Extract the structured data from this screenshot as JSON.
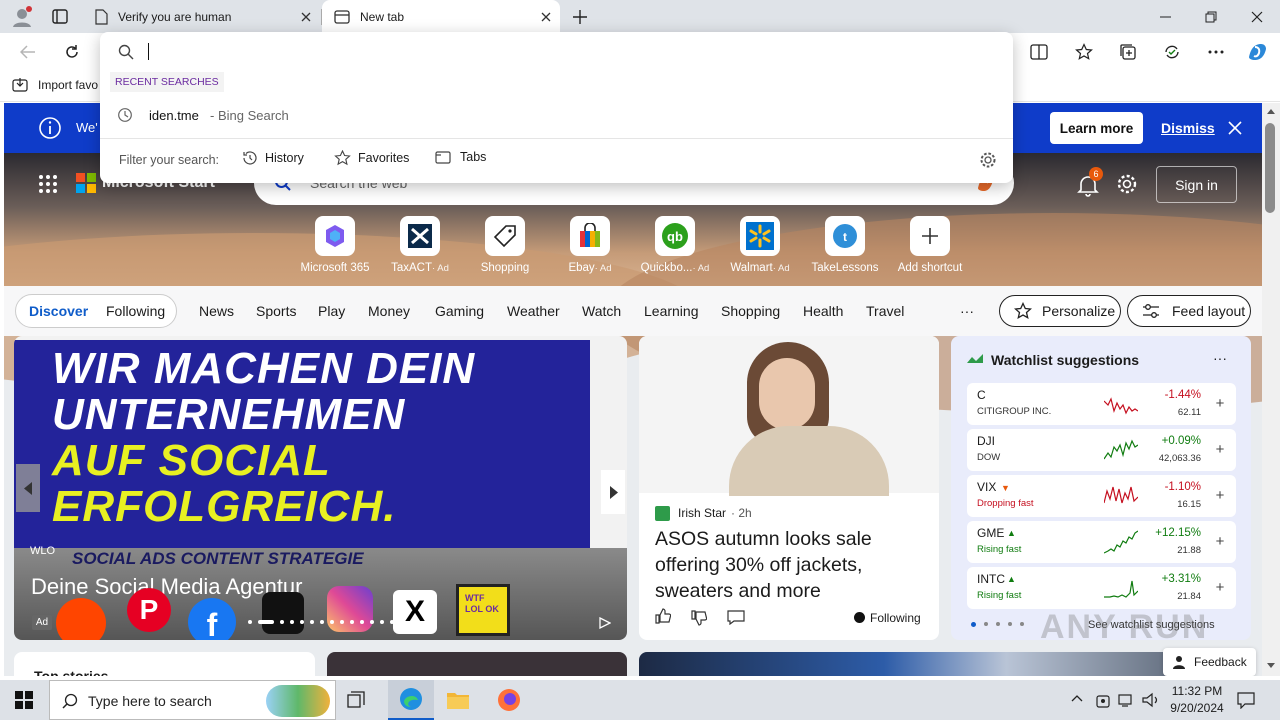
{
  "browser": {
    "tabs": [
      {
        "title": "Verify you are human"
      },
      {
        "title": "New tab"
      }
    ],
    "favorites_bar": {
      "import_label": "Import favo"
    },
    "address_dropdown": {
      "input_value": "",
      "section_label": "RECENT SEARCHES",
      "recent": [
        {
          "query": "iden.tme",
          "source": "- Bing Search"
        }
      ],
      "filter_label": "Filter your search:",
      "filters": [
        "History",
        "Favorites",
        "Tabs"
      ]
    }
  },
  "infobar": {
    "text_fragment": "We'",
    "learn_more": "Learn more",
    "dismiss": "Dismiss"
  },
  "header": {
    "brand": "Microsoft Start",
    "search_placeholder": "Search the web",
    "notification_count": "6",
    "sign_in": "Sign in"
  },
  "shortcuts": [
    {
      "label": "Microsoft 365",
      "ad": ""
    },
    {
      "label": "TaxACT",
      "ad": "· Ad"
    },
    {
      "label": "Shopping",
      "ad": ""
    },
    {
      "label": "Ebay",
      "ad": "· Ad"
    },
    {
      "label": "Quickbo...",
      "ad": "· Ad"
    },
    {
      "label": "Walmart",
      "ad": "· Ad"
    },
    {
      "label": "TakeLessons",
      "ad": ""
    },
    {
      "label": "Add shortcut",
      "ad": ""
    }
  ],
  "feed_nav": {
    "tabs": [
      "Discover",
      "Following"
    ],
    "categories": [
      "News",
      "Sports",
      "Play",
      "Money",
      "Gaming",
      "Weather",
      "Watch",
      "Learning",
      "Shopping",
      "Health",
      "Travel"
    ],
    "more": "···",
    "personalize": "Personalize",
    "feed_layout": "Feed layout"
  },
  "ad_card": {
    "line1": "WIR MACHEN DEIN",
    "line2": "UNTERNEHMEN",
    "line3": "AUF SOCIAL",
    "line4": "ERFOLGREICH.",
    "strip": "SOCIAL ADS  CONTENT  STRATEGIE",
    "brand_small": "WLO",
    "headline": "Deine Social Media Agentur",
    "ad_badge": "Ad",
    "wtf": "WTF LOL OK"
  },
  "news_card": {
    "source": "Irish Star",
    "time": "· 2h",
    "headline": "ASOS autumn looks sale offering 30% off jackets, sweaters and more",
    "following": "Following"
  },
  "watchlist": {
    "title": "Watchlist suggestions",
    "more": "···",
    "see_more": "See watchlist suggestions",
    "items": [
      {
        "symbol": "C",
        "sub": "CITIGROUP INC.",
        "change": "-1.44%",
        "price": "62.11",
        "up": false
      },
      {
        "symbol": "DJI",
        "sub": "DOW",
        "change": "+0.09%",
        "price": "42,063.36",
        "up": true
      },
      {
        "symbol": "VIX",
        "sub": "Dropping fast",
        "change": "-1.10%",
        "price": "16.15",
        "up": false
      },
      {
        "symbol": "GME",
        "sub": "Rising fast",
        "change": "+12.15%",
        "price": "21.88",
        "up": true
      },
      {
        "symbol": "INTC",
        "sub": "Rising fast",
        "change": "+3.31%",
        "price": "21.84",
        "up": true
      }
    ]
  },
  "bottom": {
    "top_stories": "Top stories",
    "feedback": "Feedback"
  },
  "taskbar": {
    "search_placeholder": "Type here to search",
    "time": "11:32 PM",
    "date": "9/20/2024"
  },
  "watermark": "ANY RUN",
  "colors": {
    "accent": "#0f3cc9",
    "up": "#107c10",
    "down": "#c50f1f",
    "orange_badge": "#e8590c"
  }
}
